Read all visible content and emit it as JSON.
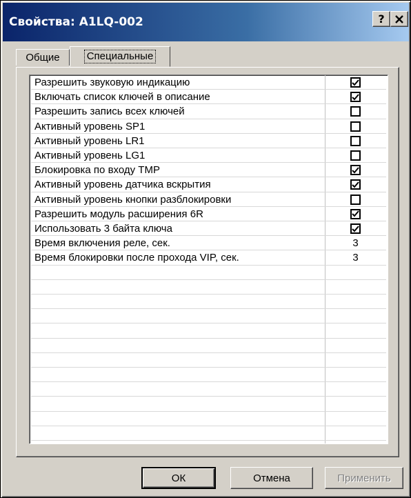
{
  "window": {
    "title": "Свойства: A1LQ-002",
    "help_label": "?",
    "close_label": "×"
  },
  "tabs": [
    {
      "label": "Общие",
      "active": false
    },
    {
      "label": "Специальные",
      "active": true
    }
  ],
  "properties": [
    {
      "label": "Разрешить звуковую индикацию",
      "type": "checkbox",
      "checked": true
    },
    {
      "label": "Включать список ключей в описание",
      "type": "checkbox",
      "checked": true
    },
    {
      "label": "Разрешить запись всех ключей",
      "type": "checkbox",
      "checked": false
    },
    {
      "label": "Активный уровень SP1",
      "type": "checkbox",
      "checked": false
    },
    {
      "label": "Активный уровень LR1",
      "type": "checkbox",
      "checked": false
    },
    {
      "label": "Активный уровень LG1",
      "type": "checkbox",
      "checked": false
    },
    {
      "label": "Блокировка по входу TMP",
      "type": "checkbox",
      "checked": true
    },
    {
      "label": "Активный уровень датчика вскрытия",
      "type": "checkbox",
      "checked": true
    },
    {
      "label": "Активный уровень кнопки разблокировки",
      "type": "checkbox",
      "checked": false
    },
    {
      "label": "Разрешить модуль расширения 6R",
      "type": "checkbox",
      "checked": true
    },
    {
      "label": "Использовать 3 байта ключа",
      "type": "checkbox",
      "checked": true
    },
    {
      "label": "Время включения реле, сек.",
      "type": "number",
      "value": "3"
    },
    {
      "label": "Время блокировки после прохода VIP, сек.",
      "type": "number",
      "value": "3"
    },
    {
      "label": "",
      "type": "empty"
    },
    {
      "label": "",
      "type": "empty"
    },
    {
      "label": "",
      "type": "empty"
    },
    {
      "label": "",
      "type": "empty"
    },
    {
      "label": "",
      "type": "empty"
    },
    {
      "label": "",
      "type": "empty"
    },
    {
      "label": "",
      "type": "empty"
    },
    {
      "label": "",
      "type": "empty"
    },
    {
      "label": "",
      "type": "empty"
    },
    {
      "label": "",
      "type": "empty"
    },
    {
      "label": "",
      "type": "empty"
    },
    {
      "label": "",
      "type": "empty"
    }
  ],
  "buttons": {
    "ok": "ОК",
    "cancel": "Отмена",
    "apply": "Применить"
  }
}
